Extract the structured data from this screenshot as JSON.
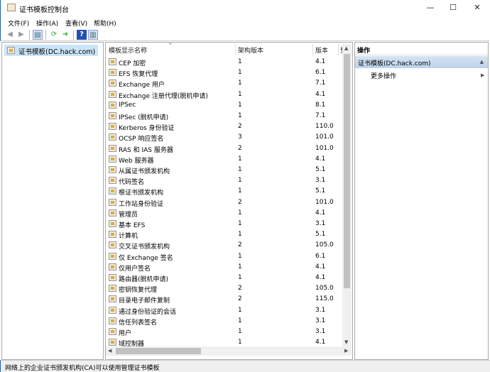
{
  "window": {
    "title": "证书模板控制台",
    "minimize": "—",
    "maximize": "☐",
    "close": "✕"
  },
  "menu": [
    "文件(F)",
    "操作(A)",
    "查看(V)",
    "帮助(H)"
  ],
  "toolbar": {
    "icons": [
      "back-icon",
      "forward-icon",
      "show-hide-tree-icon",
      "refresh-icon",
      "export-list-icon",
      "help-icon",
      "show-hide-action-pane-icon"
    ]
  },
  "tree": {
    "root": "证书模板(DC.hack.com)"
  },
  "list": {
    "columns": [
      "模板显示名称",
      "架构版本",
      "版本",
      "预"
    ],
    "rows": [
      [
        "CEP 加密",
        "1",
        "4.1"
      ],
      [
        "EFS 恢复代理",
        "1",
        "6.1"
      ],
      [
        "Exchange 用户",
        "1",
        "7.1"
      ],
      [
        "Exchange 注册代理(脱机申请)",
        "1",
        "4.1"
      ],
      [
        "IPSec",
        "1",
        "8.1"
      ],
      [
        "IPSec (脱机申请)",
        "1",
        "7.1"
      ],
      [
        "Kerberos 身份验证",
        "2",
        "110.0"
      ],
      [
        "OCSP 响应签名",
        "3",
        "101.0"
      ],
      [
        "RAS 和 IAS 服务器",
        "2",
        "101.0"
      ],
      [
        "Web 服务器",
        "1",
        "4.1"
      ],
      [
        "从属证书颁发机构",
        "1",
        "5.1"
      ],
      [
        "代码签名",
        "1",
        "3.1"
      ],
      [
        "根证书颁发机构",
        "1",
        "5.1"
      ],
      [
        "工作站身份验证",
        "2",
        "101.0"
      ],
      [
        "管理员",
        "1",
        "4.1"
      ],
      [
        "基本 EFS",
        "1",
        "3.1"
      ],
      [
        "计算机",
        "1",
        "5.1"
      ],
      [
        "交叉证书颁发机构",
        "2",
        "105.0"
      ],
      [
        "仅 Exchange 签名",
        "1",
        "6.1"
      ],
      [
        "仅用户签名",
        "1",
        "4.1"
      ],
      [
        "路由器(脱机申请)",
        "1",
        "4.1"
      ],
      [
        "密钥恢复代理",
        "2",
        "105.0"
      ],
      [
        "目录电子邮件复制",
        "2",
        "115.0"
      ],
      [
        "通过身份验证的会话",
        "1",
        "3.1"
      ],
      [
        "信任列表签名",
        "1",
        "3.1"
      ],
      [
        "用户",
        "1",
        "3.1"
      ],
      [
        "域控制器",
        "1",
        "4.1"
      ]
    ]
  },
  "actions": {
    "header": "操作",
    "selected": "证书模板(DC.hack.com)",
    "more": "更多操作"
  },
  "status": "网络上的企业证书颁发机构(CA)可以使用管理证书模板"
}
